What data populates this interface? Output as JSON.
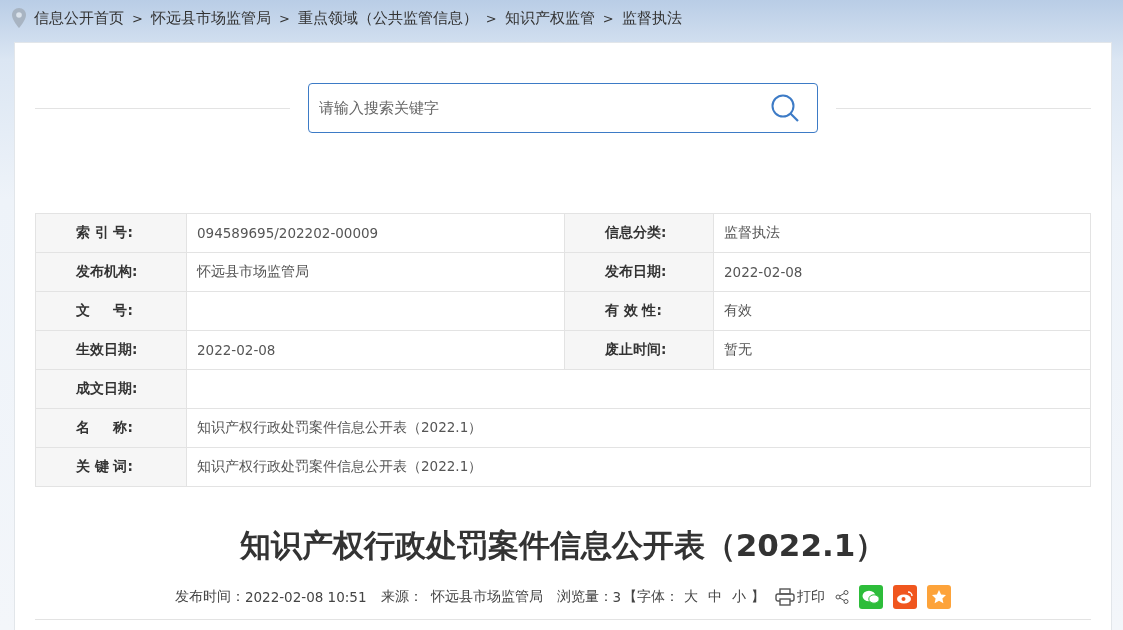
{
  "breadcrumb": [
    "信息公开首页",
    "怀远县市场监管局",
    "重点领域（公共监管信息）",
    "知识产权监管",
    "监督执法"
  ],
  "breadcrumb_separator": ">",
  "search": {
    "placeholder": "请输入搜索关键字"
  },
  "info_rows": [
    {
      "cells": [
        {
          "label": "索 引 号:",
          "value": "094589695/202202-00009"
        },
        {
          "label": "信息分类:",
          "value": "监督执法"
        }
      ]
    },
    {
      "cells": [
        {
          "label": "发布机构:",
          "value": "怀远县市场监管局"
        },
        {
          "label": "发布日期:",
          "value": "2022-02-08"
        }
      ]
    },
    {
      "cells": [
        {
          "label": "文     号:"
        },
        {
          "label": "有 效 性:",
          "value": "有效"
        }
      ]
    },
    {
      "cells": [
        {
          "label": "生效日期:",
          "value": "2022-02-08"
        },
        {
          "label": "废止时间:",
          "value": "暂无"
        }
      ]
    },
    {
      "cells": [
        {
          "label": "成文日期:"
        }
      ]
    },
    {
      "cells": [
        {
          "label": "名     称:",
          "value": "知识产权行政处罚案件信息公开表（2022.1）"
        }
      ]
    },
    {
      "cells": [
        {
          "label": "关 键 词:",
          "value": "知识产权行政处罚案件信息公开表（2022.1）"
        }
      ]
    }
  ],
  "article_title": "知识产权行政处罚案件信息公开表（2022.1）",
  "meta": {
    "publish_time_label": "发布时间：",
    "publish_time": "2022-02-08 10:51",
    "source_label": "来源：",
    "source": "怀远县市场监管局",
    "views_label": "浏览量：",
    "views": "3",
    "font_open": "【字体：",
    "font_sizes": [
      "大",
      "中",
      "小"
    ],
    "font_close": "】",
    "print": "打印"
  }
}
